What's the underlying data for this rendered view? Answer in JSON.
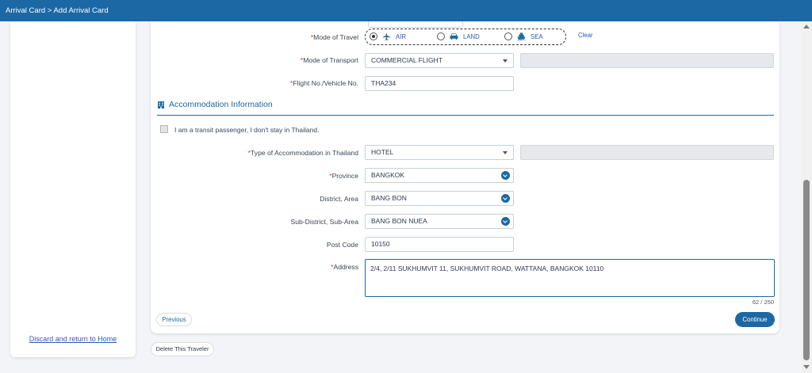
{
  "header": {
    "breadcrumb": "Arrival Card > Add Arrival Card"
  },
  "sidebar": {
    "discard_link": "Discard and return to Home"
  },
  "travel": {
    "mode_of_travel_label": "Mode of Travel",
    "options": [
      {
        "label": "AIR",
        "icon": "airplane-icon",
        "selected": true
      },
      {
        "label": "LAND",
        "icon": "car-icon",
        "selected": false
      },
      {
        "label": "SEA",
        "icon": "ship-icon",
        "selected": false
      }
    ],
    "clear_label": "Clear",
    "mode_of_transport_label": "Mode of Transport",
    "mode_of_transport_value": "COMMERCIAL FLIGHT",
    "flight_label": "Flight No./Vehicle No.",
    "flight_value": "THA234"
  },
  "accommodation": {
    "section_title": "Accommodation Information",
    "section_icon": "building-icon",
    "transit_label": "I am a transit passenger, I don't stay in Thailand.",
    "transit_checked": false,
    "type_label": "Type of Accommodation in Thailand",
    "type_value": "HOTEL",
    "province_label": "Province",
    "province_value": "BANGKOK",
    "district_label": "District, Area",
    "district_value": "BANG BON",
    "subdistrict_label": "Sub-District, Sub-Area",
    "subdistrict_value": "BANG BON NUEA",
    "postcode_label": "Post Code",
    "postcode_value": "10150",
    "address_label": "Address",
    "address_value": "2/4, 2/11 SUKHUMVIT 11, SUKHUMVIT ROAD, WATTANA, BANGKOK 10110",
    "char_count": "62 / 250"
  },
  "buttons": {
    "previous": "Previous",
    "continue": "Continue",
    "delete_traveler": "Delete This Traveler"
  },
  "required_marker": "*",
  "colors": {
    "brand": "#1b68a4",
    "required": "#e02b2b",
    "link": "#2a5bb8"
  }
}
